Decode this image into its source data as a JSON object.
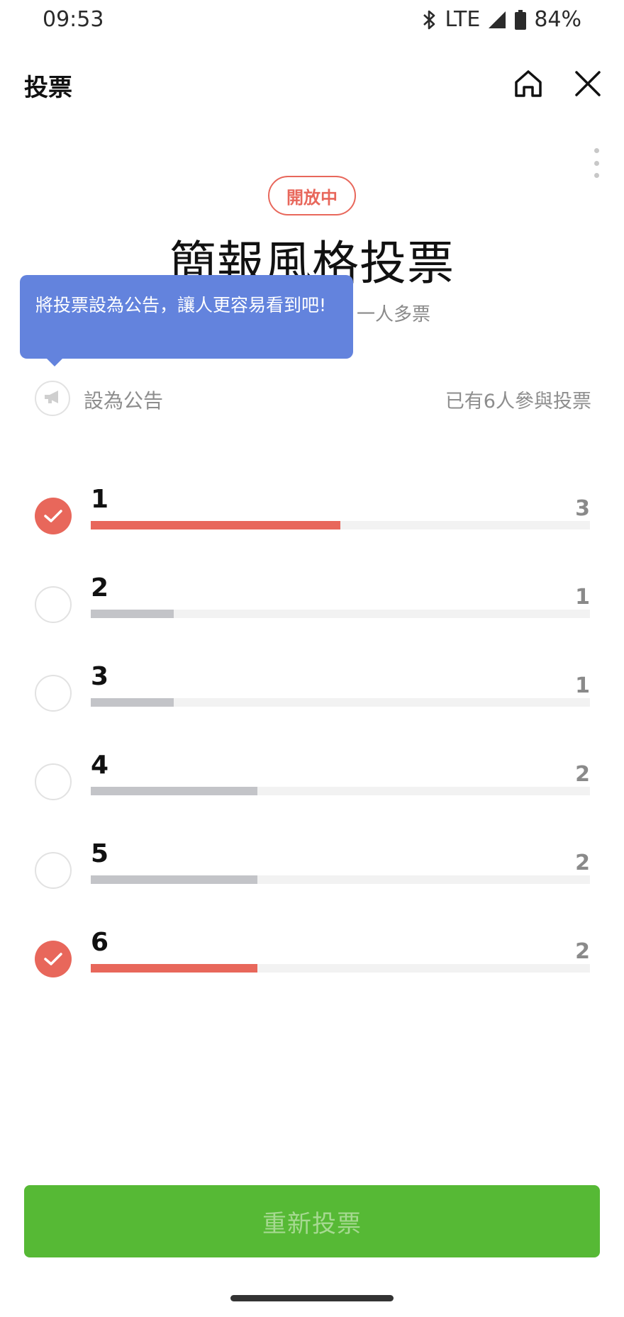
{
  "status_bar": {
    "time": "09:53",
    "network": "LTE",
    "battery": "84%"
  },
  "header": {
    "title": "投票"
  },
  "poll": {
    "status_badge": "開放中",
    "title": "簡報風格投票",
    "meta_text": "一人多票",
    "participants_text": "已有6人參與投票"
  },
  "tooltip": {
    "text": "將投票設為公告，讓人更容易看到吧!"
  },
  "announcement": {
    "label": "設為公告"
  },
  "options": [
    {
      "label": "1",
      "votes": 3,
      "selected": true
    },
    {
      "label": "2",
      "votes": 1,
      "selected": false
    },
    {
      "label": "3",
      "votes": 1,
      "selected": false
    },
    {
      "label": "4",
      "votes": 2,
      "selected": false
    },
    {
      "label": "5",
      "votes": 2,
      "selected": false
    },
    {
      "label": "6",
      "votes": 2,
      "selected": true
    }
  ],
  "actions": {
    "revote_label": "重新投票"
  },
  "colors": {
    "accent_red": "#e8675b",
    "tooltip_blue": "#6383dd",
    "bar_gray": "#c3c4c8",
    "button_green": "#56b935"
  },
  "icons": [
    "bluetooth-icon",
    "signal-icon",
    "battery-icon",
    "home-icon",
    "close-icon",
    "more-vertical-icon",
    "megaphone-icon",
    "check-icon"
  ]
}
